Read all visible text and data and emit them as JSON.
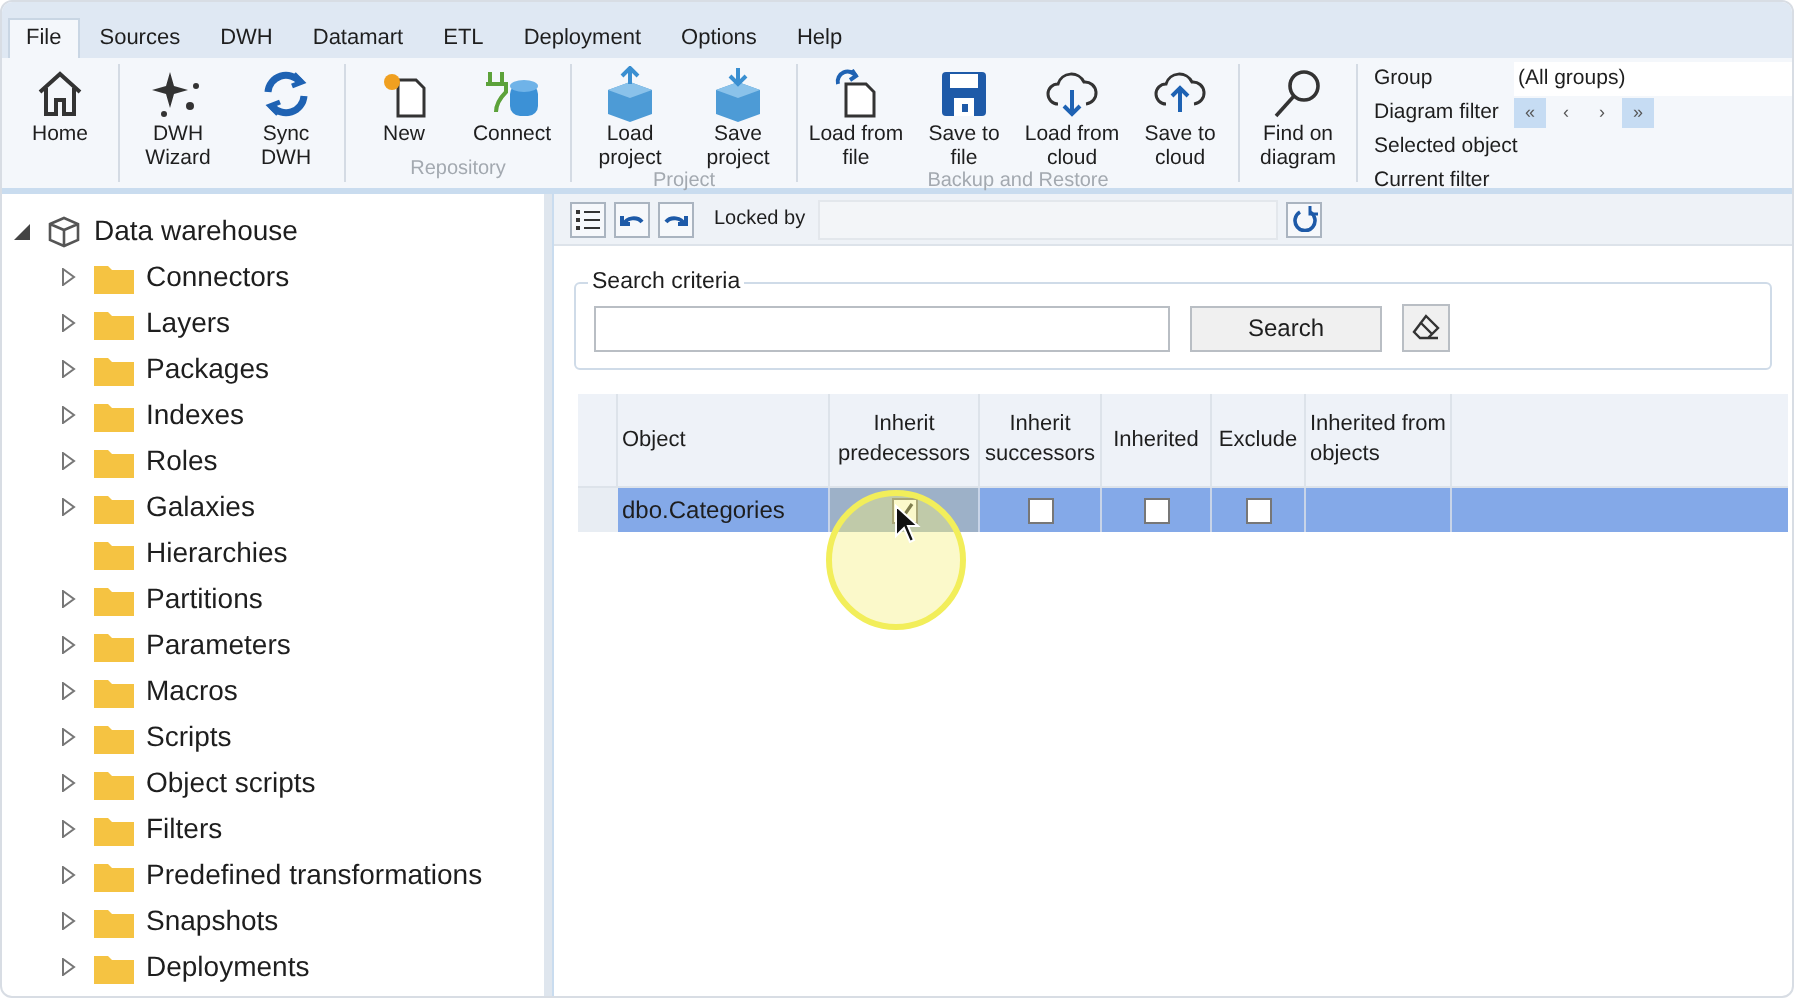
{
  "menu_tabs": [
    {
      "label": "File",
      "selected": true
    },
    {
      "label": "Sources",
      "selected": false
    },
    {
      "label": "DWH",
      "selected": false
    },
    {
      "label": "Datamart",
      "selected": false
    },
    {
      "label": "ETL",
      "selected": false
    },
    {
      "label": "Deployment",
      "selected": false
    },
    {
      "label": "Options",
      "selected": false
    },
    {
      "label": "Help",
      "selected": false
    }
  ],
  "ribbon_groups": [
    {
      "buttons": [
        "Home"
      ]
    },
    {
      "buttons": [
        "DWH Wizard",
        "Sync DWH"
      ]
    },
    {
      "label": "Repository",
      "buttons": [
        "New",
        "Connect"
      ]
    },
    {
      "label": "Project",
      "buttons": [
        "Load project",
        "Save project"
      ]
    },
    {
      "label": "Backup and Restore",
      "buttons": [
        "Load from file",
        "Save to file",
        "Load from cloud",
        "Save to cloud"
      ]
    },
    {
      "buttons": [
        "Find on diagram"
      ]
    }
  ],
  "filter_panel": {
    "group_label": "Group",
    "group_value": "(All groups)",
    "diagram_filter_label": "Diagram filter",
    "nav_buttons": [
      "«",
      "‹",
      "›",
      "»"
    ],
    "selected_object_label": "Selected object",
    "current_filter_label": "Current filter"
  },
  "tree": {
    "label": "Data warehouse",
    "expanded": true,
    "children": [
      {
        "label": "Connectors",
        "expandable": true
      },
      {
        "label": "Layers",
        "expandable": true
      },
      {
        "label": "Packages",
        "expandable": true
      },
      {
        "label": "Indexes",
        "expandable": true
      },
      {
        "label": "Roles",
        "expandable": true
      },
      {
        "label": "Galaxies",
        "expandable": true
      },
      {
        "label": "Hierarchies",
        "expandable": false
      },
      {
        "label": "Partitions",
        "expandable": true
      },
      {
        "label": "Parameters",
        "expandable": true
      },
      {
        "label": "Macros",
        "expandable": true
      },
      {
        "label": "Scripts",
        "expandable": true
      },
      {
        "label": "Object scripts",
        "expandable": true
      },
      {
        "label": "Filters",
        "expandable": true
      },
      {
        "label": "Predefined transformations",
        "expandable": true
      },
      {
        "label": "Snapshots",
        "expandable": true
      },
      {
        "label": "Deployments",
        "expandable": true
      }
    ]
  },
  "toolbar": {
    "locked_by_label": "Locked by"
  },
  "search": {
    "title": "Search criteria",
    "button": "Search"
  },
  "table": {
    "columns": [
      "Object",
      "Inherit predecessors",
      "Inherit successors",
      "Inherited",
      "Exclude",
      "Inherited from objects"
    ],
    "rows": [
      {
        "object": "dbo.Categories",
        "selected": true,
        "inherit_predecessors": true,
        "inherit_successors": false,
        "inherited": false,
        "exclude": false
      }
    ]
  }
}
